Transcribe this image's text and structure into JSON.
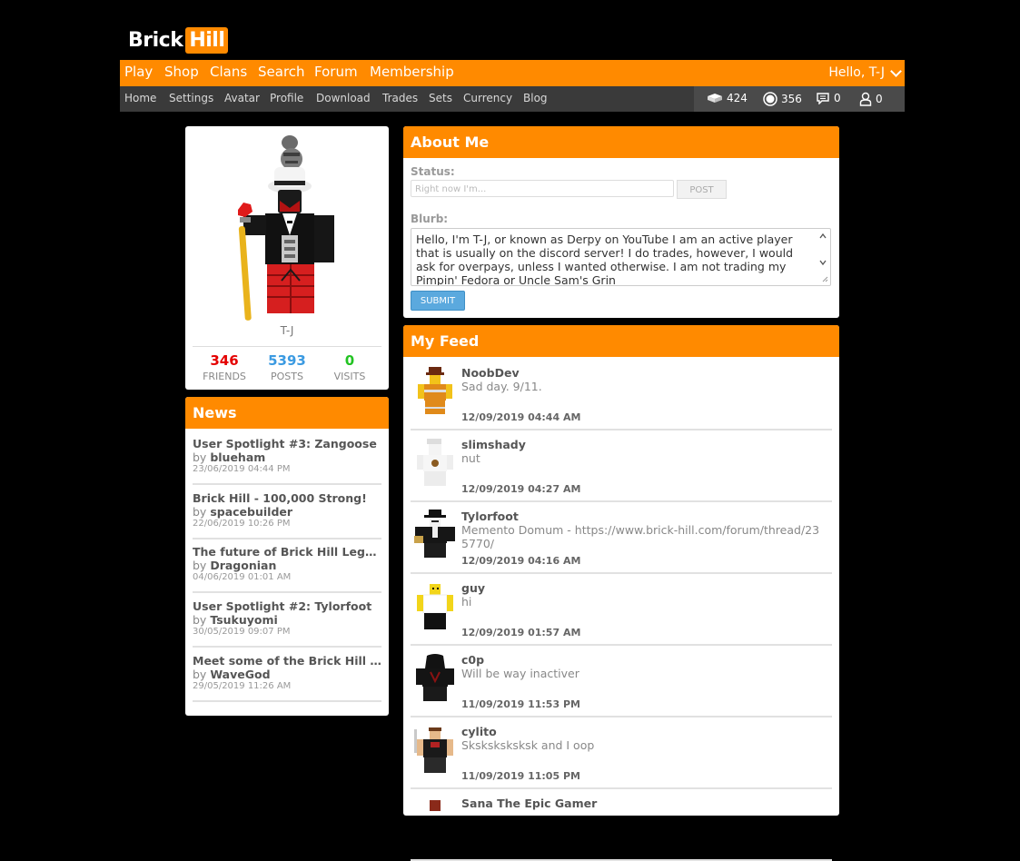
{
  "logo": {
    "word1": "Brick",
    "word2": "Hill"
  },
  "topnav": {
    "items": [
      "Play",
      "Shop",
      "Clans",
      "Search",
      "Forum",
      "Membership"
    ],
    "greeting": "Hello, T-J"
  },
  "subnav": {
    "items": [
      "Home",
      "Settings",
      "Avatar",
      "Profile",
      "Download",
      "Trades",
      "Sets",
      "Currency",
      "Blog"
    ],
    "stats": {
      "bricks": "424",
      "bucks": "356",
      "messages": "0",
      "friend_requests": "0"
    }
  },
  "profile": {
    "username": "T-J",
    "friends": {
      "value": "346",
      "label": "FRIENDS",
      "color": "#e40000"
    },
    "posts": {
      "value": "5393",
      "label": "POSTS",
      "color": "#3b9ae1"
    },
    "visits": {
      "value": "0",
      "label": "VISITS",
      "color": "#22c322"
    }
  },
  "news": {
    "title": "News",
    "items": [
      {
        "title": "User Spotlight #3: Zangoose",
        "by": "by",
        "author": "blueham",
        "date": "23/06/2019 04:44 PM"
      },
      {
        "title": "Brick Hill - 100,000 Strong!",
        "by": "by",
        "author": "spacebuilder",
        "date": "22/06/2019 10:26 PM"
      },
      {
        "title": "The future of Brick Hill Legacy...",
        "by": "by",
        "author": "Dragonian",
        "date": "04/06/2019 01:01 AM"
      },
      {
        "title": "User Spotlight #2: Tylorfoot",
        "by": "by",
        "author": "Tsukuyomi",
        "date": "30/05/2019 09:07 PM"
      },
      {
        "title": "Meet some of the Brick Hill st...",
        "by": "by",
        "author": "WaveGod",
        "date": "29/05/2019 11:26 AM"
      }
    ]
  },
  "about": {
    "title": "About Me",
    "status_label": "Status:",
    "status_placeholder": "Right now I'm...",
    "post_button": "POST",
    "blurb_label": "Blurb:",
    "blurb_text": "Hello, I'm T-J, or known as Derpy on YouTube I am an active player that is usually on the discord server! I do trades, however, I would ask for overpays, unless I wanted otherwise. I am not trading my Pimpin' Fedora or Uncle Sam's Grin",
    "submit_button": "SUBMIT"
  },
  "feed": {
    "title": "My Feed",
    "items": [
      {
        "name": "NoobDev",
        "message": "Sad day. 9/11.",
        "date": "12/09/2019 04:44 AM"
      },
      {
        "name": "slimshady",
        "message": "nut",
        "date": "12/09/2019 04:27 AM"
      },
      {
        "name": "Tylorfoot",
        "message": "Memento Domum - https://www.brick-hill.com/forum/thread/235770/",
        "date": "12/09/2019 04:16 AM"
      },
      {
        "name": "guy",
        "message": "hi",
        "date": "12/09/2019 01:57 AM"
      },
      {
        "name": "c0p",
        "message": "Will be way inactiver",
        "date": "11/09/2019 11:53 PM"
      },
      {
        "name": "cylito",
        "message": "Sksksksksksk and I oop",
        "date": "11/09/2019 11:05 PM"
      },
      {
        "name": "Sana The Epic Gamer",
        "message": "",
        "date": ""
      }
    ]
  },
  "colors": {
    "accent": "#ff8a00",
    "subnav": "#3a3a3a",
    "submit": "#5ba9de"
  }
}
